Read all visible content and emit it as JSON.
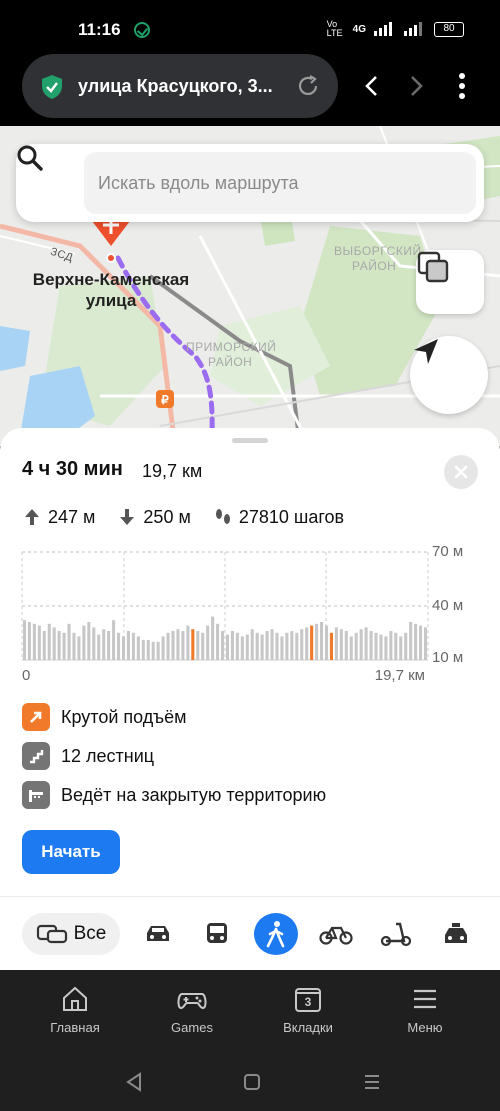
{
  "status_bar": {
    "time": "11:16",
    "network_label": "Vo LTE",
    "network_type": "4G",
    "battery": "80"
  },
  "browser": {
    "url_text": "улица Красуцкого, 3...",
    "icons": [
      "shield-icon",
      "reload-icon",
      "back-icon",
      "forward-icon",
      "more-icon"
    ]
  },
  "map": {
    "search_placeholder": "Искать вдоль маршрута",
    "destination_label_line1": "Верхне-Каменская",
    "destination_label_line2": "улица",
    "districts": [
      {
        "line1": "ВЫБОРГСКИЙ",
        "line2": "РАЙОН"
      },
      {
        "line1": "ПРИМОРСКИЙ",
        "line2": "РАЙОН"
      }
    ],
    "road_label": "ЗСД",
    "route_color": "#9b6cf0"
  },
  "route": {
    "duration": "4 ч 30 мин",
    "distance": "19,7 км",
    "ascent": "247 м",
    "descent": "250 м",
    "steps": "27810 шагов"
  },
  "chart_data": {
    "type": "bar",
    "title": "",
    "xlabel": "",
    "ylabel": "",
    "x_start_label": "0",
    "x_end_label": "19,7 км",
    "y_ticks": [
      "70 м",
      "40 м",
      "10 м"
    ],
    "ylim": [
      10,
      70
    ],
    "values": [
      31,
      30,
      29,
      28,
      25,
      29,
      27,
      25,
      24,
      29,
      24,
      22,
      28,
      30,
      27,
      23,
      26,
      25,
      31,
      24,
      22,
      25,
      24,
      22,
      20,
      20,
      19,
      19,
      22,
      24,
      25,
      26,
      25,
      28,
      26,
      25,
      24,
      28,
      33,
      29,
      25,
      23,
      25,
      24,
      22,
      23,
      26,
      24,
      23,
      25,
      26,
      24,
      22,
      24,
      25,
      24,
      26,
      27,
      28,
      29,
      30,
      28,
      24,
      27,
      26,
      25,
      22,
      24,
      26,
      27,
      25,
      24,
      23,
      22,
      25,
      24,
      22,
      24,
      30,
      29,
      28,
      27
    ],
    "highlight_indices": [
      34,
      58,
      62
    ],
    "bar_color": "#c7c7c7",
    "highlight_color": "#f07a2a",
    "grid": true
  },
  "features": [
    {
      "label": "Крутой подъём",
      "icon": "steep-climb-icon",
      "color": "#f07a2a"
    },
    {
      "label": "12 лестниц",
      "icon": "stairs-icon",
      "color": "#757575"
    },
    {
      "label": "Ведёт на закрытую территорию",
      "icon": "restricted-area-icon",
      "color": "#757575"
    }
  ],
  "start_label": "Начать",
  "modes": {
    "all_label": "Все",
    "items": [
      "car-icon",
      "bus-icon",
      "walking-icon",
      "bicycle-icon",
      "scooter-icon",
      "taxi-icon"
    ],
    "active": "walking-icon"
  },
  "bottom_nav": {
    "home": "Главная",
    "games": "Games",
    "tabs": "Вкладки",
    "tabs_count": "3",
    "menu": "Меню"
  }
}
